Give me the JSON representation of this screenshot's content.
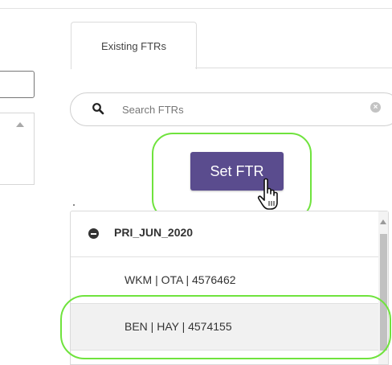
{
  "tabs": [
    {
      "label": "Existing FTRs",
      "active": true
    }
  ],
  "search": {
    "placeholder": "Search FTRs",
    "value": "",
    "icon": "search-icon",
    "clear_icon": "clear-icon"
  },
  "actions": {
    "set_ftr_label": "Set FTR"
  },
  "ftr_list": {
    "groups": [
      {
        "label": "PRI_JUN_2020",
        "expanded": true,
        "items": [
          {
            "label": "WKM | OTA | 4576462",
            "selected": false
          },
          {
            "label": "BEN | HAY | 4574155",
            "selected": true
          }
        ]
      }
    ]
  },
  "colors": {
    "button": "#5a4c8e",
    "highlight": "#6fe33d",
    "selected_row": "#f1f1f1"
  }
}
